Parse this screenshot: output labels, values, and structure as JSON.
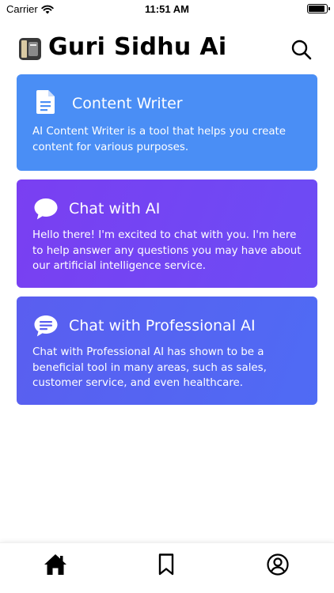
{
  "status_bar": {
    "carrier": "Carrier",
    "time": "11:51 AM",
    "battery_level": 0.9
  },
  "header": {
    "title": "Guri Sidhu Ai"
  },
  "cards": [
    {
      "title": "Content Writer",
      "description": "AI Content Writer is a tool that helps you create content for various purposes.",
      "icon": "document-icon"
    },
    {
      "title": "Chat with AI",
      "description": "Hello there! I'm excited to chat with you. I'm here to help answer any questions you may have about our artificial intelligence service.",
      "icon": "chat-bubble-icon"
    },
    {
      "title": "Chat with Professional AI",
      "description": "Chat with Professional AI has shown to be a beneficial tool in many areas, such as sales, customer service, and even healthcare.",
      "icon": "chat-lines-icon"
    }
  ],
  "tab_bar": {
    "tabs": [
      "home-icon",
      "bookmark-icon",
      "profile-icon"
    ],
    "active": "home-icon"
  },
  "colors": {
    "card_writer": "#4a8ef5",
    "card_chat": "#7a3ff2",
    "card_pro": "#5a5ef0"
  }
}
